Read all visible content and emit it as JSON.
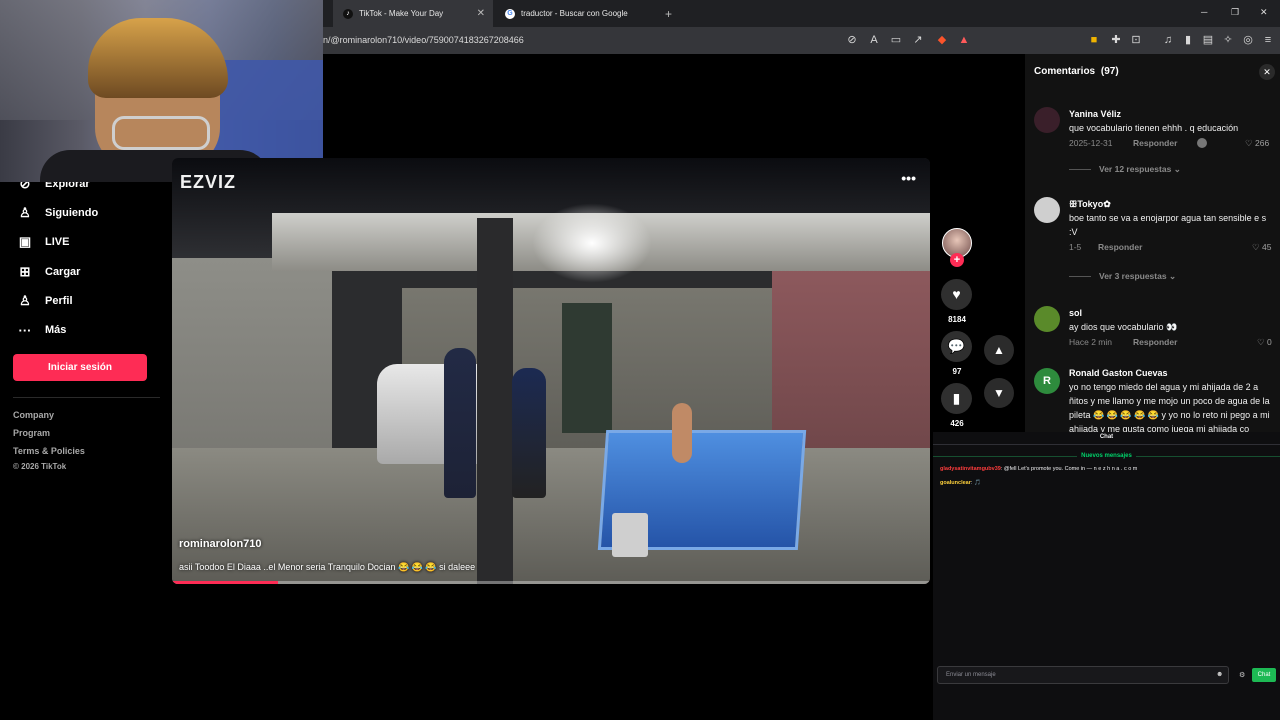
{
  "browser": {
    "tabs": [
      {
        "label": "TikTok - Make Your Day",
        "active": true,
        "icon": "tiktok-icon"
      },
      {
        "label": "traductor - Buscar con Google",
        "active": false,
        "icon": "google-icon"
      }
    ],
    "new_tab": "+",
    "url": "n/@rominarolon710/video/7590074183267208466",
    "window_controls": {
      "minimize": "─",
      "restore": "❐",
      "close": "✕"
    }
  },
  "sidebar": {
    "items": [
      {
        "label": "Explorar",
        "icon": "compass-icon"
      },
      {
        "label": "Siguiendo",
        "icon": "following-icon"
      },
      {
        "label": "LIVE",
        "icon": "live-icon"
      },
      {
        "label": "Cargar",
        "icon": "upload-icon"
      },
      {
        "label": "Perfil",
        "icon": "profile-icon"
      },
      {
        "label": "Más",
        "icon": "more-icon"
      }
    ],
    "login_label": "Iniciar sesión",
    "footer_links": [
      "Company",
      "Program",
      "Terms & Policies"
    ],
    "copyright": "© 2026 TikTok"
  },
  "video": {
    "watermark": "EZVIZ",
    "more_label": "•••",
    "author": "rominarolon710",
    "caption": "asii Toodoo El Diaaa ..el Menor seria Tranquilo Docian 😂 😂 😂 si daleee",
    "progress": 0.14
  },
  "actions": {
    "likes": "8184",
    "comments": "97",
    "saves": "426"
  },
  "comments_panel": {
    "title": "Comentarios",
    "count": "(97)",
    "items": [
      {
        "user": "Yanina Véliz",
        "text": "que vocabulario tienen ehhh . q educación",
        "date": "2025-12-31",
        "reply": "Responder",
        "likes": "266",
        "more": "Ver 12 respuestas",
        "avatar_color": "#3a1f2a"
      },
      {
        "user": "ꕥTokyo✿",
        "text": "boe tanto se va a enojarpor agua tan sensible e s :V",
        "date": "1-5",
        "reply": "Responder",
        "likes": "45",
        "more": "Ver 3 respuestas",
        "avatar_color": "#cfcfcf"
      },
      {
        "user": "sol",
        "text": "ay dios que vocabulario 👀",
        "date": "Hace 2 min",
        "reply": "Responder",
        "likes": "0",
        "more": "",
        "avatar_color": "#5a8a2a"
      },
      {
        "user": "Ronald Gaston Cuevas",
        "text": "yo no tengo miedo del agua y mi ahijada de 2 a ñitos y me llamo y me mojo un poco de agua de la pileta 😂 😂 😂 😂 😂 y yo no lo reto ni pego a mi ahijada y me gusta como juega mi ahijada co",
        "date": "",
        "reply": "",
        "likes": "",
        "more": "",
        "avatar_color": "#2e8b3d",
        "avatar_letter": "R"
      }
    ]
  },
  "chat": {
    "title": "Chat",
    "new_messages": "Nuevos mensajes",
    "messages": [
      {
        "user": "gladysatinvitamgubv39",
        "text": "@fell Let's promote you. Come in — n e z h n a . c o m"
      },
      {
        "user": "goalunclear",
        "text": "🎵"
      }
    ],
    "input_placeholder": "Enviar un mensaje",
    "send_label": "Chat"
  }
}
